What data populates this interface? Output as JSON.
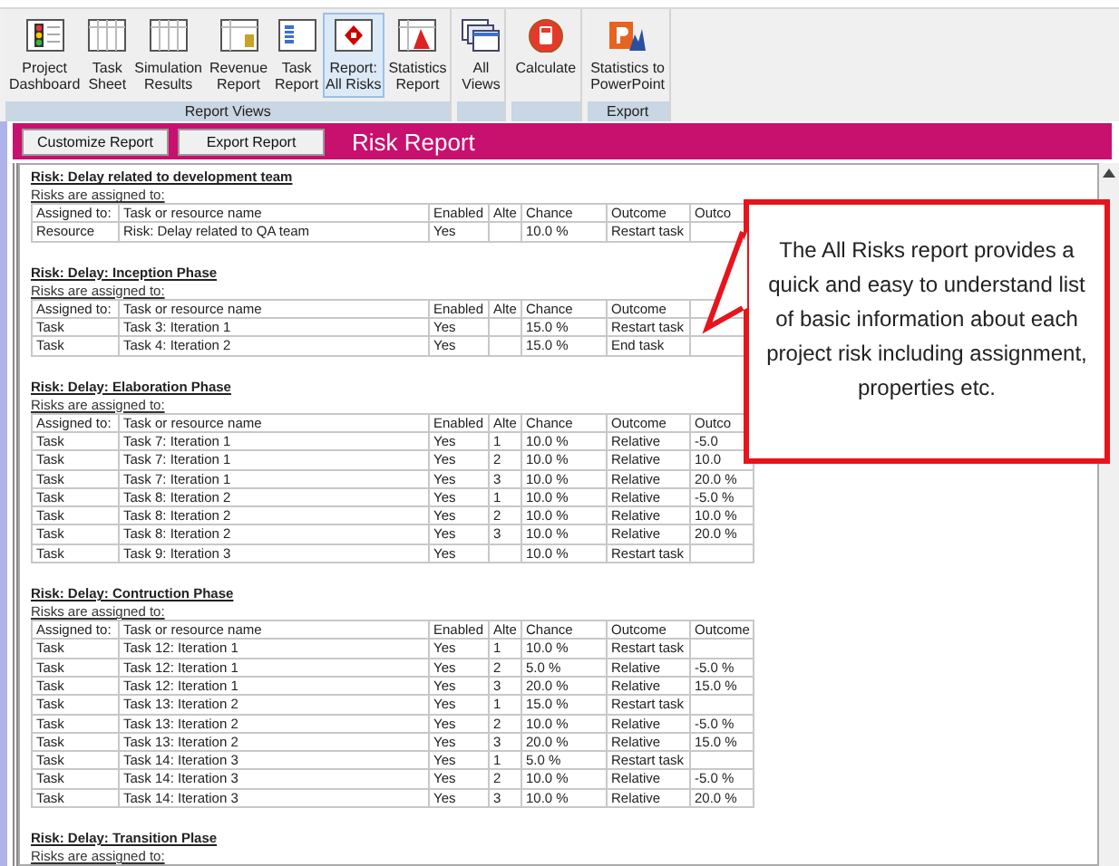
{
  "ribbon": {
    "groups": [
      {
        "label": "Report Views",
        "buttons": [
          {
            "label": "Project\nDashboard",
            "selected": false
          },
          {
            "label": "Task\nSheet",
            "selected": false
          },
          {
            "label": "Simulation\nResults",
            "selected": false
          },
          {
            "label": "Revenue\nReport",
            "selected": false
          },
          {
            "label": "Task\nReport",
            "selected": false
          },
          {
            "label": "Report:\nAll Risks",
            "selected": true
          },
          {
            "label": "Statistics\nReport",
            "selected": false
          }
        ]
      },
      {
        "buttons": [
          {
            "label": "All\nViews",
            "selected": false
          }
        ]
      },
      {
        "buttons": [
          {
            "label": "Calculate",
            "selected": false
          }
        ]
      },
      {
        "label": "Export",
        "buttons": [
          {
            "label": "Statistics to\nPowerPoint",
            "selected": false
          }
        ]
      }
    ]
  },
  "report_bar": {
    "buttons": [
      "Customize Report",
      "Export Report"
    ],
    "title": "Risk Report"
  },
  "sections": [
    {
      "title": "Risk: Delay related to development team",
      "subtitle": "Risks are assigned to:",
      "columns": [
        "Assigned to:",
        "Task or resource name",
        "Enabled",
        "Alte",
        "Chance",
        "Outcome",
        "Outco"
      ],
      "rows": [
        [
          "Resource",
          "Risk: Delay related to QA team",
          "Yes",
          null,
          "10.0 %",
          "Restart task",
          null
        ]
      ]
    },
    {
      "title": "Risk: Delay: Inception Phase",
      "subtitle": "Risks are assigned to:",
      "columns": [
        "Assigned to:",
        "Task or resource name",
        "Enabled",
        "Alte",
        "Chance",
        "Outcome"
      ],
      "rows": [
        [
          "Task",
          "Task 3: Iteration 1",
          "Yes",
          null,
          "15.0 %",
          "Restart task",
          null
        ],
        [
          "Task",
          "Task 4: Iteration 2",
          "Yes",
          null,
          "15.0 %",
          "End task",
          null
        ]
      ]
    },
    {
      "title": "Risk: Delay: Elaboration Phase",
      "subtitle": "Risks are assigned to:",
      "columns": [
        "Assigned to:",
        "Task or resource name",
        "Enabled",
        "Alte",
        "Chance",
        "Outcome",
        "Outco"
      ],
      "rows": [
        [
          "Task",
          "Task 7: Iteration 1",
          "Yes",
          "1",
          "10.0 %",
          "Relative",
          "-5.0"
        ],
        [
          "Task",
          "Task 7: Iteration 1",
          "Yes",
          "2",
          "10.0 %",
          "Relative",
          "10.0"
        ],
        [
          "Task",
          "Task 7: Iteration 1",
          "Yes",
          "3",
          "10.0 %",
          "Relative",
          "20.0 %"
        ],
        [
          "Task",
          "Task 8: Iteration 2",
          "Yes",
          "1",
          "10.0 %",
          "Relative",
          "-5.0 %"
        ],
        [
          "Task",
          "Task 8: Iteration 2",
          "Yes",
          "2",
          "10.0 %",
          "Relative",
          "10.0 %"
        ],
        [
          "Task",
          "Task 8: Iteration 2",
          "Yes",
          "3",
          "10.0 %",
          "Relative",
          "20.0 %"
        ],
        [
          "Task",
          "Task 9: Iteration 3",
          "Yes",
          null,
          "10.0 %",
          "Restart task",
          null
        ]
      ]
    },
    {
      "title": "Risk: Delay: Contruction Phase",
      "subtitle": "Risks are assigned to:",
      "columns": [
        "Assigned to:",
        "Task or resource name",
        "Enabled",
        "Alte",
        "Chance",
        "Outcome",
        "Outcome"
      ],
      "rows": [
        [
          "Task",
          "Task 12: Iteration 1",
          "Yes",
          "1",
          "10.0 %",
          "Restart task",
          null
        ],
        [
          "Task",
          "Task 12: Iteration 1",
          "Yes",
          "2",
          "5.0 %",
          "Relative",
          "-5.0 %"
        ],
        [
          "Task",
          "Task 12: Iteration 1",
          "Yes",
          "3",
          "20.0 %",
          "Relative",
          "15.0 %"
        ],
        [
          "Task",
          "Task 13: Iteration 2",
          "Yes",
          "1",
          "15.0 %",
          "Restart task",
          null
        ],
        [
          "Task",
          "Task 13: Iteration 2",
          "Yes",
          "2",
          "10.0 %",
          "Relative",
          "-5.0 %"
        ],
        [
          "Task",
          "Task 13: Iteration 2",
          "Yes",
          "3",
          "20.0 %",
          "Relative",
          "15.0 %"
        ],
        [
          "Task",
          "Task 14: Iteration 3",
          "Yes",
          "1",
          "5.0 %",
          "Restart task",
          null
        ],
        [
          "Task",
          "Task 14: Iteration 3",
          "Yes",
          "2",
          "10.0 %",
          "Relative",
          "-5.0 %"
        ],
        [
          "Task",
          "Task 14: Iteration 3",
          "Yes",
          "3",
          "10.0 %",
          "Relative",
          "20.0 %"
        ]
      ]
    },
    {
      "title": "Risk: Delay: Transition Plase",
      "subtitle": "Risks are assigned to:"
    }
  ],
  "callout": {
    "text": "The All Risks report provides a quick and easy to understand list of basic information about each project risk including assignment, properties etc."
  }
}
